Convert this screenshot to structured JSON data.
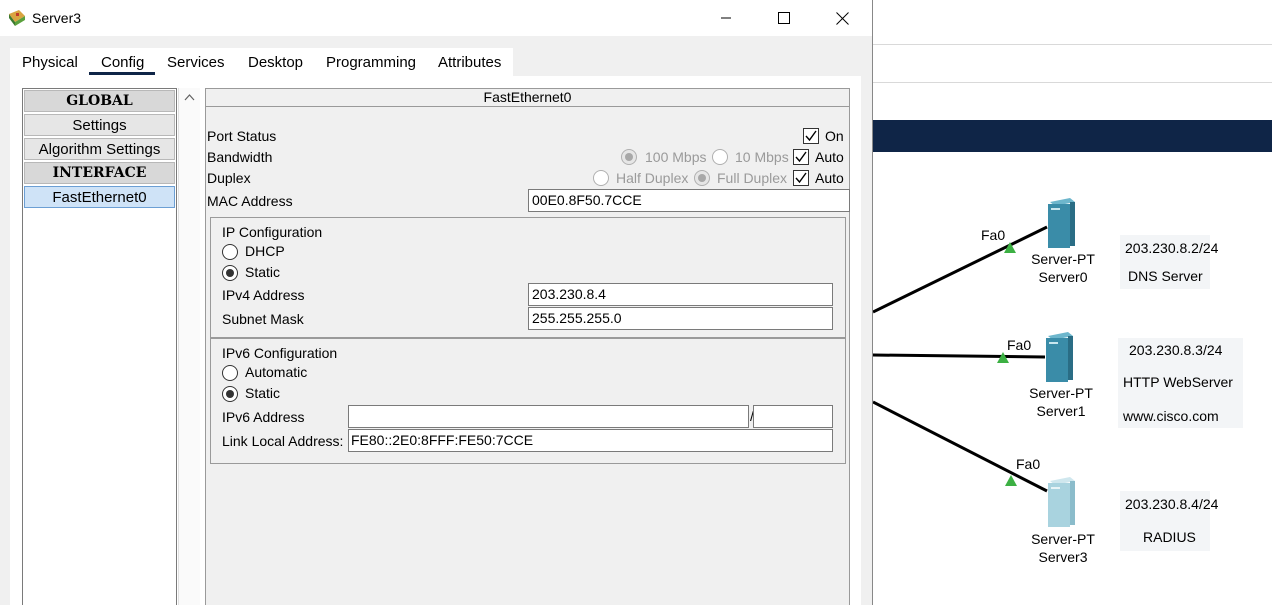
{
  "window": {
    "title": "Server3",
    "controls": {
      "minimize": "minimize-icon",
      "maximize": "maximize-icon",
      "close": "close-icon"
    }
  },
  "tabs": [
    {
      "label": "Physical"
    },
    {
      "label": "Config",
      "active": true
    },
    {
      "label": "Services"
    },
    {
      "label": "Desktop"
    },
    {
      "label": "Programming"
    },
    {
      "label": "Attributes"
    }
  ],
  "sidebar": {
    "items": [
      {
        "label": "GLOBAL",
        "type": "header"
      },
      {
        "label": "Settings"
      },
      {
        "label": "Algorithm Settings"
      },
      {
        "label": "INTERFACE",
        "type": "header"
      },
      {
        "label": "FastEthernet0",
        "selected": true
      }
    ]
  },
  "panel": {
    "title": "FastEthernet0",
    "port_status": {
      "label": "Port Status",
      "on_label": "On",
      "on_checked": true
    },
    "bandwidth": {
      "label": "Bandwidth",
      "opt1": "100 Mbps",
      "opt2": "10 Mbps",
      "auto_label": "Auto",
      "auto_checked": true
    },
    "duplex": {
      "label": "Duplex",
      "opt1": "Half Duplex",
      "opt2": "Full Duplex",
      "auto_label": "Auto",
      "auto_checked": true
    },
    "mac": {
      "label": "MAC Address",
      "value": "00E0.8F50.7CCE"
    },
    "ipv4": {
      "heading": "IP Configuration",
      "dhcp_label": "DHCP",
      "static_label": "Static",
      "mode": "Static",
      "address_label": "IPv4 Address",
      "address": "203.230.8.4",
      "mask_label": "Subnet Mask",
      "mask": "255.255.255.0"
    },
    "ipv6": {
      "heading": "IPv6 Configuration",
      "auto_label": "Automatic",
      "static_label": "Static",
      "mode": "Static",
      "address_label": "IPv6 Address",
      "address": "",
      "separator": "/",
      "prefix": "",
      "link_local_label": "Link Local Address:",
      "link_local": "FE80::2E0:8FFF:FE50:7CCE"
    }
  },
  "topology": {
    "servers": [
      {
        "port": "Fa0",
        "model": "Server-PT",
        "name": "Server0",
        "ip": "203.230.8.2/24",
        "notes": [
          "DNS Server"
        ]
      },
      {
        "port": "Fa0",
        "model": "Server-PT",
        "name": "Server1",
        "ip": "203.230.8.3/24",
        "notes": [
          "HTTP WebServer",
          "www.cisco.com"
        ]
      },
      {
        "port": "Fa0",
        "model": "Server-PT",
        "name": "Server3",
        "ip": "203.230.8.4/24",
        "notes": [
          "RADIUS"
        ]
      }
    ],
    "colors": {
      "navbar": "#0f2547",
      "link_up": "#3cb043",
      "server": "#3a8ca8",
      "server_selected": "#a9d3df"
    }
  }
}
